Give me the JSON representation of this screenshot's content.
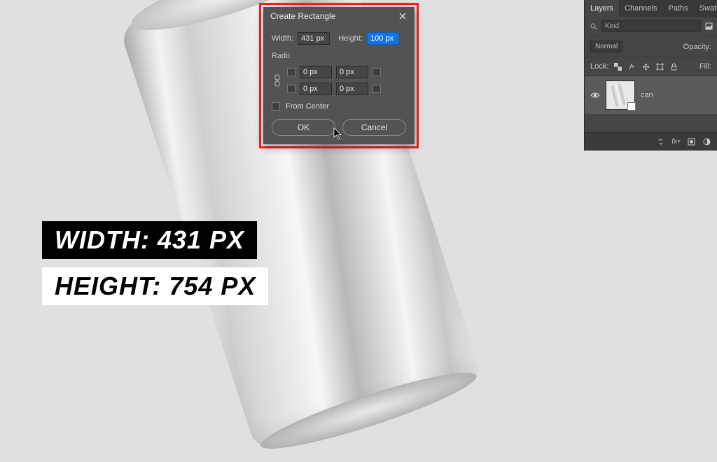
{
  "dialog": {
    "title": "Create Rectangle",
    "widthLabel": "Width:",
    "widthValue": "431 px",
    "heightLabel": "Height:",
    "heightValue": "100 px",
    "radiiLabel": "Radii:",
    "radii": {
      "tl": "0 px",
      "tr": "0 px",
      "bl": "0 px",
      "br": "0 px"
    },
    "fromCenterLabel": "From Center",
    "okLabel": "OK",
    "cancelLabel": "Cancel"
  },
  "overlay": {
    "widthLine": "WIDTH: 431 PX",
    "heightLine": "HEIGHT: 754 PX"
  },
  "layers": {
    "tabs": [
      "Layers",
      "Channels",
      "Paths",
      "Swatches"
    ],
    "filterPlaceholder": "Kind",
    "blendMode": "Normal",
    "opacityLabel": "Opacity:",
    "lockLabel": "Lock:",
    "fillLabel": "Fill:",
    "layerName": "can"
  }
}
